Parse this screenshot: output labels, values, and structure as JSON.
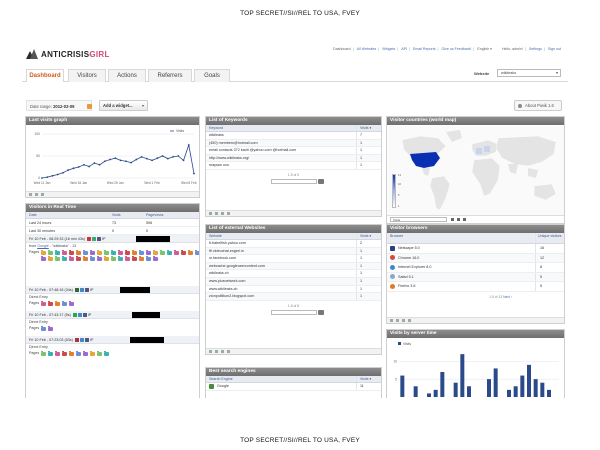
{
  "classification": {
    "top": "TOP SECRET//SI//REL TO USA, FVEY",
    "bottom": "TOP SECRET//SI//REL TO USA, FVEY"
  },
  "logo": {
    "text_main": "ANTICRISIS",
    "text_accent": "GIRL",
    "sub": "2.0"
  },
  "top_links": [
    "Dashboard",
    "All Websites",
    "Widgets",
    "API",
    "Email Reports",
    "Give us Feedback!",
    "English ▾",
    "Hello, admin!",
    "Settings",
    "Sign out"
  ],
  "nav": {
    "tabs": [
      "Dashboard",
      "Visitors",
      "Actions",
      "Referrers",
      "Goals"
    ],
    "website_label": "Website",
    "website_value": "wikileaks"
  },
  "toolbar": {
    "date_label": "Date range:",
    "date_value": "2012-02-09",
    "add_widget": "Add a widget...",
    "about": "About Piwik 1.6"
  },
  "visits_graph": {
    "title": "Last visits graph",
    "y_ticks": [
      "100",
      "50",
      "0"
    ],
    "x_ticks": [
      "Wed 11 Jan",
      "Wed 18 Jan",
      "Wed 25 Jan",
      "Wed 1 Feb",
      "Wed 8 Feb"
    ],
    "legend_label": "Visits"
  },
  "chart_data": {
    "type": "line",
    "title": "Last visits graph",
    "x": [
      "Wed 11 Jan",
      "",
      "",
      "",
      "",
      "",
      "",
      "Wed 18 Jan",
      "",
      "",
      "",
      "",
      "",
      "",
      "Wed 25 Jan",
      "",
      "",
      "",
      "",
      "",
      "",
      "Wed 1 Feb",
      "",
      "",
      "",
      "",
      "",
      "",
      "Wed 8 Feb",
      ""
    ],
    "series": [
      {
        "name": "Visits",
        "values": [
          0,
          2,
          5,
          8,
          12,
          18,
          22,
          25,
          30,
          26,
          34,
          30,
          38,
          42,
          45,
          40,
          38,
          35,
          42,
          48,
          44,
          40,
          45,
          50,
          44,
          48,
          50,
          40,
          75,
          10
        ]
      }
    ],
    "ylim": [
      0,
      100
    ],
    "y_ticks": [
      0,
      50,
      100
    ]
  },
  "realtime": {
    "title": "Visitors in Real Time",
    "headers": [
      "Date",
      "Visits",
      "Pageviews"
    ],
    "rows": [
      {
        "label": "Last 24 hours",
        "visits": "73",
        "pageviews": "596"
      },
      {
        "label": "Last 30 minutes",
        "visits": "0",
        "pageviews": "0"
      }
    ],
    "visits": [
      {
        "time": "Fri 10 Feb - 08:29:33 (16 min 43s)",
        "ip_prefix": "IP",
        "from_prefix": "from",
        "from_link": "Google",
        "from_rest": "- \"wikileaks\" - 13",
        "pages_label": "Pages",
        "page_count": 40
      },
      {
        "time": "Fri 10 Feb - 07:48:16 (34s)",
        "ip_prefix": "IP",
        "entry": "Direct Entry",
        "pages_label": "Pages",
        "page_count": 5
      },
      {
        "time": "Fri 10 Feb - 07:43:17 (5s)",
        "ip_prefix": "IP",
        "entry": "Direct Entry",
        "pages_label": "Pages",
        "page_count": 2
      },
      {
        "time": "Fri 10 Feb - 07:23:03 (53s)",
        "ip_prefix": "IP",
        "entry": "Direct Entry",
        "pages_label": "Pages",
        "page_count": 10
      }
    ]
  },
  "keywords": {
    "title": "List of Keywords",
    "col_label": "Keyword",
    "col_value": "Visits ▾",
    "rows": [
      {
        "label": "wikileaks",
        "value": "7"
      },
      {
        "label": "(450) members@hotmail.com",
        "value": "1"
      },
      {
        "label": "email contacts 372 kadri @yahoo.com @hotmail.com",
        "value": "1"
      },
      {
        "label": "http://www.wikileaks.org/",
        "value": "1"
      },
      {
        "label": "maysan uxo",
        "value": "1"
      }
    ],
    "pager": "1-5 of 5"
  },
  "external_sites": {
    "title": "List of external Websites",
    "col_label": "Website",
    "col_value": "Visits ▾",
    "rows": [
      {
        "label": "fr.babelfish.yahoo.com",
        "value": "2"
      },
      {
        "label": "ftl.videochat.engeri.in",
        "value": "1"
      },
      {
        "label": "m.facebook.com",
        "value": "1"
      },
      {
        "label": "webcache.googleusercontent.com",
        "value": "1"
      },
      {
        "label": "wikileaks.ch",
        "value": "1"
      },
      {
        "label": "www.plusnetwork.com",
        "value": "1"
      },
      {
        "label": "www.wikileaks.ch",
        "value": "1"
      },
      {
        "label": "zionpolitikon2.blogspot.com",
        "value": "1"
      }
    ],
    "pager": "1-8 of 8"
  },
  "search_engines": {
    "title": "Best search engines",
    "col_label": "Search Engine",
    "col_value": "Visits ▾",
    "rows": [
      {
        "label": "Google",
        "value": "11"
      }
    ]
  },
  "countries": {
    "title": "Visitor countries (world map)",
    "legend": [
      "13",
      "10",
      "5",
      "1"
    ],
    "select": "Visits"
  },
  "browsers": {
    "title": "Visitor browsers",
    "col_label": "Browser",
    "col_value": "Unique visitors",
    "rows": [
      {
        "label": "Netscape 5.0",
        "value": "16",
        "color": "#2c3e88"
      },
      {
        "label": "Chrome 16.0",
        "value": "12",
        "color": "#d24a3a"
      },
      {
        "label": "Internet Explorer 8.0",
        "value": "8",
        "color": "#3a8ad2"
      },
      {
        "label": "Safari 5.1",
        "value": "5",
        "color": "#8aa6c8"
      },
      {
        "label": "Firefox 3.6",
        "value": "5",
        "color": "#e07a2a"
      }
    ],
    "pager": "1-5 of 13",
    "pager_next": "Next ›"
  },
  "server_time": {
    "title": "Visits by server time",
    "legend_label": "Visits",
    "y_ticks": [
      "10",
      "5"
    ],
    "values": [
      6,
      0,
      3,
      0,
      1,
      2,
      7,
      0,
      4,
      12,
      3,
      0,
      0,
      5,
      8,
      0,
      2,
      3,
      6,
      9,
      5,
      4,
      2,
      0
    ]
  },
  "colors": {
    "accent_tab": "#d25c1b",
    "widget_title_bg": "#7a7a7a",
    "link": "#4a6ea9",
    "map_usa": "#0a2fb3"
  }
}
